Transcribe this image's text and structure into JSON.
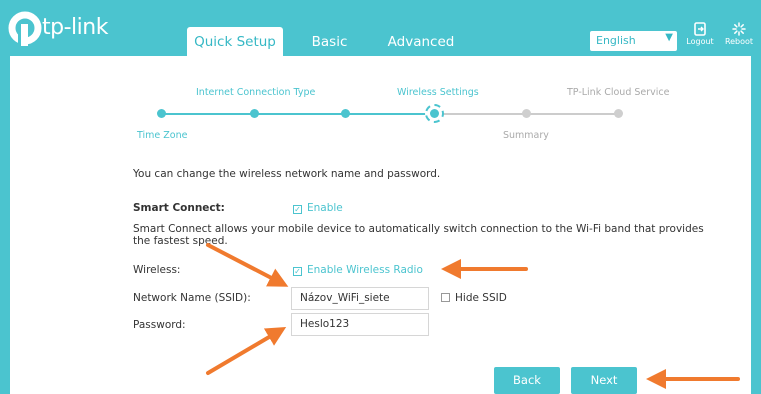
{
  "brand": {
    "logo_text": "tp-link",
    "color_primary": "#4bc4cf",
    "arrow_color": "#f07a2e"
  },
  "nav": {
    "tabs": [
      {
        "label": "Quick Setup",
        "active": true
      },
      {
        "label": "Basic",
        "active": false
      },
      {
        "label": "Advanced",
        "active": false
      }
    ],
    "language": {
      "selected": "English"
    },
    "logout_label": "Logout",
    "reboot_label": "Reboot"
  },
  "progress": {
    "steps": [
      {
        "label": "Time Zone",
        "state": "done"
      },
      {
        "label": "Internet Connection Type",
        "state": "done"
      },
      {
        "label": "Wireless Settings",
        "state": "current"
      },
      {
        "label": "Summary",
        "state": "pending"
      },
      {
        "label": "TP-Link Cloud Service",
        "state": "pending"
      }
    ]
  },
  "content": {
    "intro": "You can change the wireless network name and password.",
    "smart_connect": {
      "label": "Smart Connect:",
      "enable_label": "Enable",
      "checked": true,
      "description_line1": "Smart Connect allows your mobile device to automatically switch connection to the Wi-Fi band that provides",
      "description_line2": "the fastest speed."
    },
    "wireless": {
      "label": "Wireless:",
      "enable_label": "Enable Wireless Radio",
      "checked": true
    },
    "ssid": {
      "label": "Network Name (SSID):",
      "value": "Názov_WiFi_siete",
      "hide_label": "Hide SSID",
      "hide_checked": false
    },
    "password": {
      "label": "Password:",
      "value": "Heslo123"
    }
  },
  "buttons": {
    "back": "Back",
    "next": "Next"
  }
}
